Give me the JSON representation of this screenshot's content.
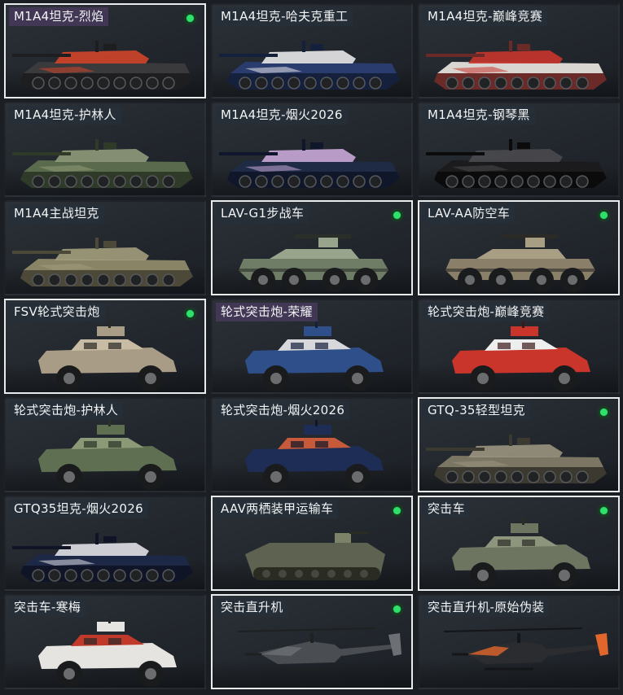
{
  "vehicles": [
    {
      "name": "M1A4坦克-烈焰",
      "kind": "tank",
      "selected": true,
      "equipped": true,
      "label_style": "purple",
      "colors": {
        "body": "#3a3a3c",
        "accent": "#d2452a",
        "dark": "#1e1e20"
      }
    },
    {
      "name": "M1A4坦克-哈夫克重工",
      "kind": "tank",
      "selected": false,
      "equipped": false,
      "label_style": "",
      "colors": {
        "body": "#2a3b6e",
        "accent": "#e8e8ea",
        "dark": "#15203d"
      }
    },
    {
      "name": "M1A4坦克-巅峰竞赛",
      "kind": "tank",
      "selected": false,
      "equipped": false,
      "label_style": "",
      "colors": {
        "body": "#d9d6d2",
        "accent": "#c8352c",
        "dark": "#6a2a28"
      }
    },
    {
      "name": "M1A4坦克-护林人",
      "kind": "tank",
      "selected": false,
      "equipped": false,
      "label_style": "",
      "colors": {
        "body": "#5a6b4d",
        "accent": "#8f9a7a",
        "dark": "#2f3a28"
      }
    },
    {
      "name": "M1A4坦克-烟火2026",
      "kind": "tank",
      "selected": false,
      "equipped": false,
      "label_style": "",
      "colors": {
        "body": "#1f2a45",
        "accent": "#c9a9d8",
        "dark": "#10172a"
      }
    },
    {
      "name": "M1A4坦克-钢琴黑",
      "kind": "tank",
      "selected": false,
      "equipped": false,
      "label_style": "",
      "colors": {
        "body": "#1b1b1d",
        "accent": "#4a4a4e",
        "dark": "#0b0b0c"
      }
    },
    {
      "name": "M1A4主战坦克",
      "kind": "tank",
      "selected": false,
      "equipped": false,
      "label_style": "",
      "colors": {
        "body": "#8a8466",
        "accent": "#a39d7c",
        "dark": "#4c4938"
      }
    },
    {
      "name": "LAV-G1步战车",
      "kind": "apc",
      "selected": true,
      "equipped": true,
      "label_style": "",
      "colors": {
        "body": "#6f7d66",
        "accent": "#98a58c",
        "dark": "#2b2f2a"
      }
    },
    {
      "name": "LAV-AA防空车",
      "kind": "apc",
      "selected": true,
      "equipped": true,
      "label_style": "",
      "colors": {
        "body": "#8a8069",
        "accent": "#a89e84",
        "dark": "#2b2a26"
      }
    },
    {
      "name": "FSV轮式突击炮",
      "kind": "car",
      "selected": true,
      "equipped": true,
      "label_style": "",
      "colors": {
        "body": "#a89c86",
        "accent": "#c8bca4",
        "dark": "#2a2824"
      }
    },
    {
      "name": "轮式突击炮-荣耀",
      "kind": "car",
      "selected": false,
      "equipped": false,
      "label_style": "purple",
      "colors": {
        "body": "#2e4f8a",
        "accent": "#d8d8dc",
        "dark": "#15203a"
      }
    },
    {
      "name": "轮式突击炮-巅峰竞赛",
      "kind": "car",
      "selected": false,
      "equipped": false,
      "label_style": "",
      "colors": {
        "body": "#c9352a",
        "accent": "#eeeeee",
        "dark": "#3a1a18"
      }
    },
    {
      "name": "轮式突击炮-护林人",
      "kind": "car",
      "selected": false,
      "equipped": false,
      "label_style": "",
      "colors": {
        "body": "#5f7052",
        "accent": "#8c9977",
        "dark": "#2a3226"
      }
    },
    {
      "name": "轮式突击炮-烟火2026",
      "kind": "car",
      "selected": false,
      "equipped": false,
      "label_style": "",
      "colors": {
        "body": "#1e2d55",
        "accent": "#c65a3a",
        "dark": "#10172a"
      }
    },
    {
      "name": "GTQ-35轻型坦克",
      "kind": "tank",
      "selected": true,
      "equipped": true,
      "label_style": "",
      "colors": {
        "body": "#7b7664",
        "accent": "#9a957f",
        "dark": "#3c3a30"
      }
    },
    {
      "name": "GTQ35坦克-烟火2026",
      "kind": "tank",
      "selected": false,
      "equipped": false,
      "label_style": "",
      "colors": {
        "body": "#1d2846",
        "accent": "#e0e0e6",
        "dark": "#0f1426"
      }
    },
    {
      "name": "AAV两栖装甲运输车",
      "kind": "aav",
      "selected": true,
      "equipped": true,
      "label_style": "",
      "colors": {
        "body": "#5d6350",
        "accent": "#7b8268",
        "dark": "#2a2c24"
      }
    },
    {
      "name": "突击车",
      "kind": "car",
      "selected": true,
      "equipped": true,
      "label_style": "",
      "colors": {
        "body": "#6d7560",
        "accent": "#8d957d",
        "dark": "#2a2c26"
      }
    },
    {
      "name": "突击车-寒梅",
      "kind": "car",
      "selected": false,
      "equipped": false,
      "label_style": "",
      "colors": {
        "body": "#e6e4e0",
        "accent": "#c0392b",
        "dark": "#2a2826"
      }
    },
    {
      "name": "突击直升机",
      "kind": "heli",
      "selected": true,
      "equipped": true,
      "label_style": "",
      "colors": {
        "body": "#4a4e52",
        "accent": "#6c7074",
        "dark": "#1e2022"
      }
    },
    {
      "name": "突击直升机-原始伪装",
      "kind": "heli",
      "selected": false,
      "equipped": false,
      "label_style": "",
      "colors": {
        "body": "#2a2c30",
        "accent": "#e0662c",
        "dark": "#141518"
      }
    }
  ],
  "equipped_icon": "equipped-dot-icon"
}
